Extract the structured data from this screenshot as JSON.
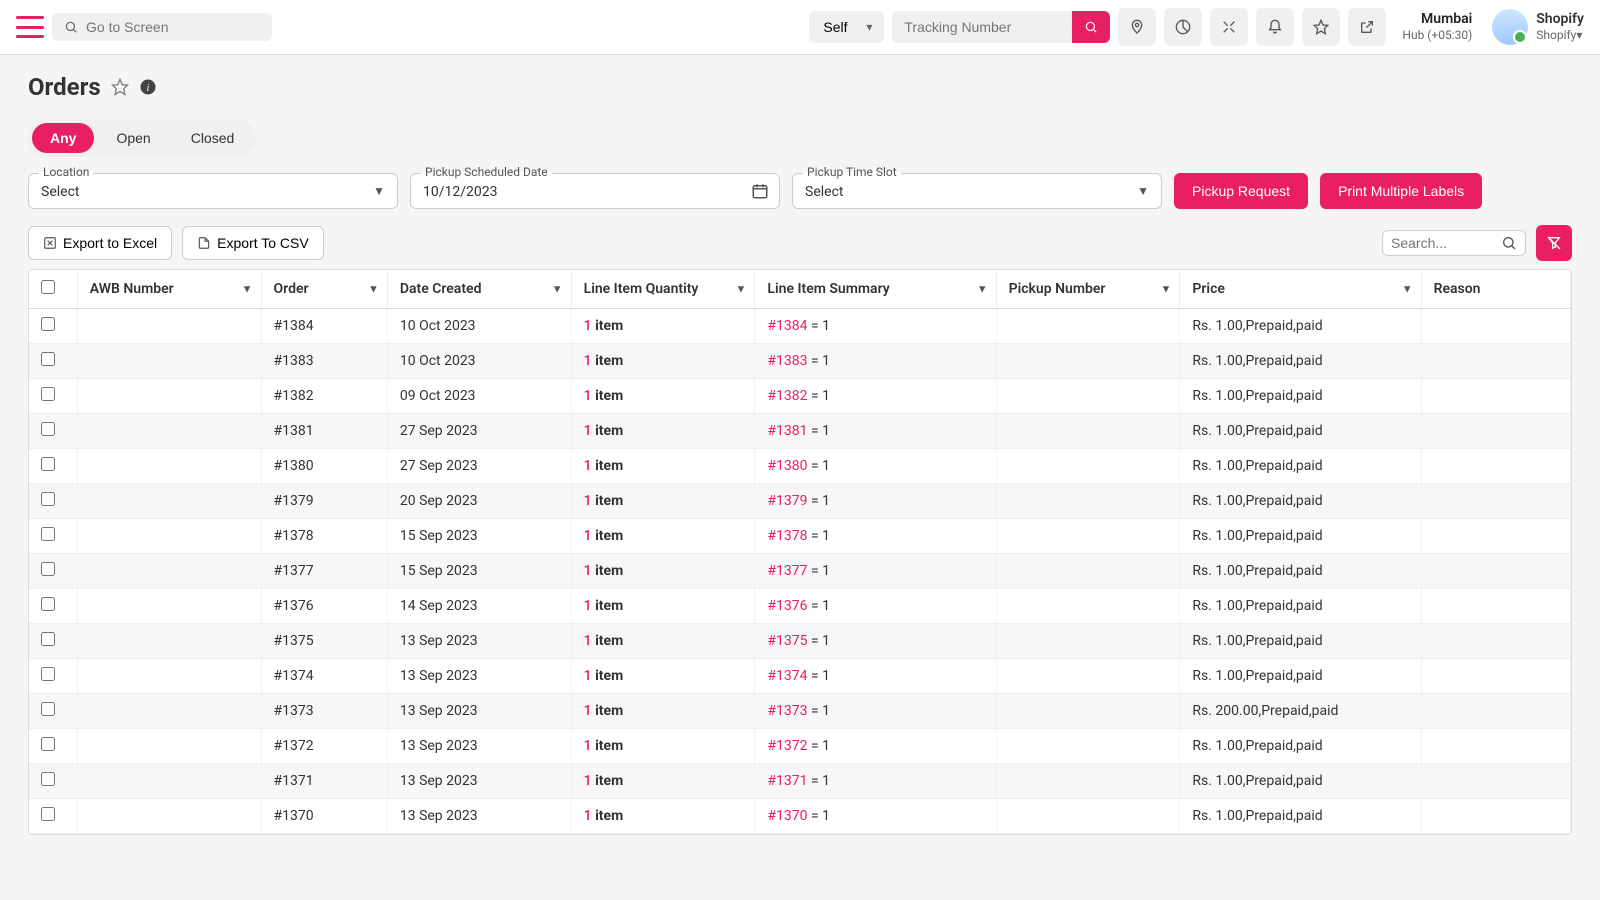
{
  "topbar": {
    "go_to_screen_placeholder": "Go to Screen",
    "self_select": "Self",
    "tracking_placeholder": "Tracking Number",
    "region_city": "Mumbai",
    "region_hub": "Hub (+05:30)",
    "user_name": "Shopify",
    "user_sub": "Shopify"
  },
  "page": {
    "title": "Orders",
    "tabs": [
      "Any",
      "Open",
      "Closed"
    ],
    "active_tab_index": 0,
    "location_label": "Location",
    "location_value": "Select",
    "date_label": "Pickup Scheduled Date",
    "date_value": "10/12/2023",
    "slot_label": "Pickup Time Slot",
    "slot_value": "Select",
    "pickup_request_btn": "Pickup Request",
    "print_labels_btn": "Print Multiple Labels",
    "export_excel": "Export to Excel",
    "export_csv": "Export To CSV",
    "search_placeholder": "Search..."
  },
  "table": {
    "headers": {
      "awb": "AWB Number",
      "order": "Order",
      "date": "Date Created",
      "qty": "Line Item Quantity",
      "summary": "Line Item Summary",
      "pickup": "Pickup Number",
      "price": "Price",
      "reason": "Reason"
    },
    "rows": [
      {
        "awb": "",
        "order": "#1384",
        "date": "10 Oct 2023",
        "qty_n": "1",
        "qty_t": "item",
        "sum_n": "#1384",
        "sum_t": "= 1",
        "pickup": "",
        "price": "Rs. 1.00,Prepaid,paid",
        "reason": ""
      },
      {
        "awb": "",
        "order": "#1383",
        "date": "10 Oct 2023",
        "qty_n": "1",
        "qty_t": "item",
        "sum_n": "#1383",
        "sum_t": "= 1",
        "pickup": "",
        "price": "Rs. 1.00,Prepaid,paid",
        "reason": ""
      },
      {
        "awb": "",
        "order": "#1382",
        "date": "09 Oct 2023",
        "qty_n": "1",
        "qty_t": "item",
        "sum_n": "#1382",
        "sum_t": "= 1",
        "pickup": "",
        "price": "Rs. 1.00,Prepaid,paid",
        "reason": ""
      },
      {
        "awb": "",
        "order": "#1381",
        "date": "27 Sep 2023",
        "qty_n": "1",
        "qty_t": "item",
        "sum_n": "#1381",
        "sum_t": "= 1",
        "pickup": "",
        "price": "Rs. 1.00,Prepaid,paid",
        "reason": ""
      },
      {
        "awb": "",
        "order": "#1380",
        "date": "27 Sep 2023",
        "qty_n": "1",
        "qty_t": "item",
        "sum_n": "#1380",
        "sum_t": "= 1",
        "pickup": "",
        "price": "Rs. 1.00,Prepaid,paid",
        "reason": ""
      },
      {
        "awb": "",
        "order": "#1379",
        "date": "20 Sep 2023",
        "qty_n": "1",
        "qty_t": "item",
        "sum_n": "#1379",
        "sum_t": "= 1",
        "pickup": "",
        "price": "Rs. 1.00,Prepaid,paid",
        "reason": ""
      },
      {
        "awb": "",
        "order": "#1378",
        "date": "15 Sep 2023",
        "qty_n": "1",
        "qty_t": "item",
        "sum_n": "#1378",
        "sum_t": "= 1",
        "pickup": "",
        "price": "Rs. 1.00,Prepaid,paid",
        "reason": ""
      },
      {
        "awb": "",
        "order": "#1377",
        "date": "15 Sep 2023",
        "qty_n": "1",
        "qty_t": "item",
        "sum_n": "#1377",
        "sum_t": "= 1",
        "pickup": "",
        "price": "Rs. 1.00,Prepaid,paid",
        "reason": ""
      },
      {
        "awb": "",
        "order": "#1376",
        "date": "14 Sep 2023",
        "qty_n": "1",
        "qty_t": "item",
        "sum_n": "#1376",
        "sum_t": "= 1",
        "pickup": "",
        "price": "Rs. 1.00,Prepaid,paid",
        "reason": ""
      },
      {
        "awb": "",
        "order": "#1375",
        "date": "13 Sep 2023",
        "qty_n": "1",
        "qty_t": "item",
        "sum_n": "#1375",
        "sum_t": "= 1",
        "pickup": "",
        "price": "Rs. 1.00,Prepaid,paid",
        "reason": ""
      },
      {
        "awb": "",
        "order": "#1374",
        "date": "13 Sep 2023",
        "qty_n": "1",
        "qty_t": "item",
        "sum_n": "#1374",
        "sum_t": "= 1",
        "pickup": "",
        "price": "Rs. 1.00,Prepaid,paid",
        "reason": ""
      },
      {
        "awb": "",
        "order": "#1373",
        "date": "13 Sep 2023",
        "qty_n": "1",
        "qty_t": "item",
        "sum_n": "#1373",
        "sum_t": "= 1",
        "pickup": "",
        "price": "Rs. 200.00,Prepaid,paid",
        "reason": ""
      },
      {
        "awb": "",
        "order": "#1372",
        "date": "13 Sep 2023",
        "qty_n": "1",
        "qty_t": "item",
        "sum_n": "#1372",
        "sum_t": "= 1",
        "pickup": "",
        "price": "Rs. 1.00,Prepaid,paid",
        "reason": ""
      },
      {
        "awb": "",
        "order": "#1371",
        "date": "13 Sep 2023",
        "qty_n": "1",
        "qty_t": "item",
        "sum_n": "#1371",
        "sum_t": "= 1",
        "pickup": "",
        "price": "Rs. 1.00,Prepaid,paid",
        "reason": ""
      },
      {
        "awb": "",
        "order": "#1370",
        "date": "13 Sep 2023",
        "qty_n": "1",
        "qty_t": "item",
        "sum_n": "#1370",
        "sum_t": "= 1",
        "pickup": "",
        "price": "Rs. 1.00,Prepaid,paid",
        "reason": ""
      }
    ]
  }
}
